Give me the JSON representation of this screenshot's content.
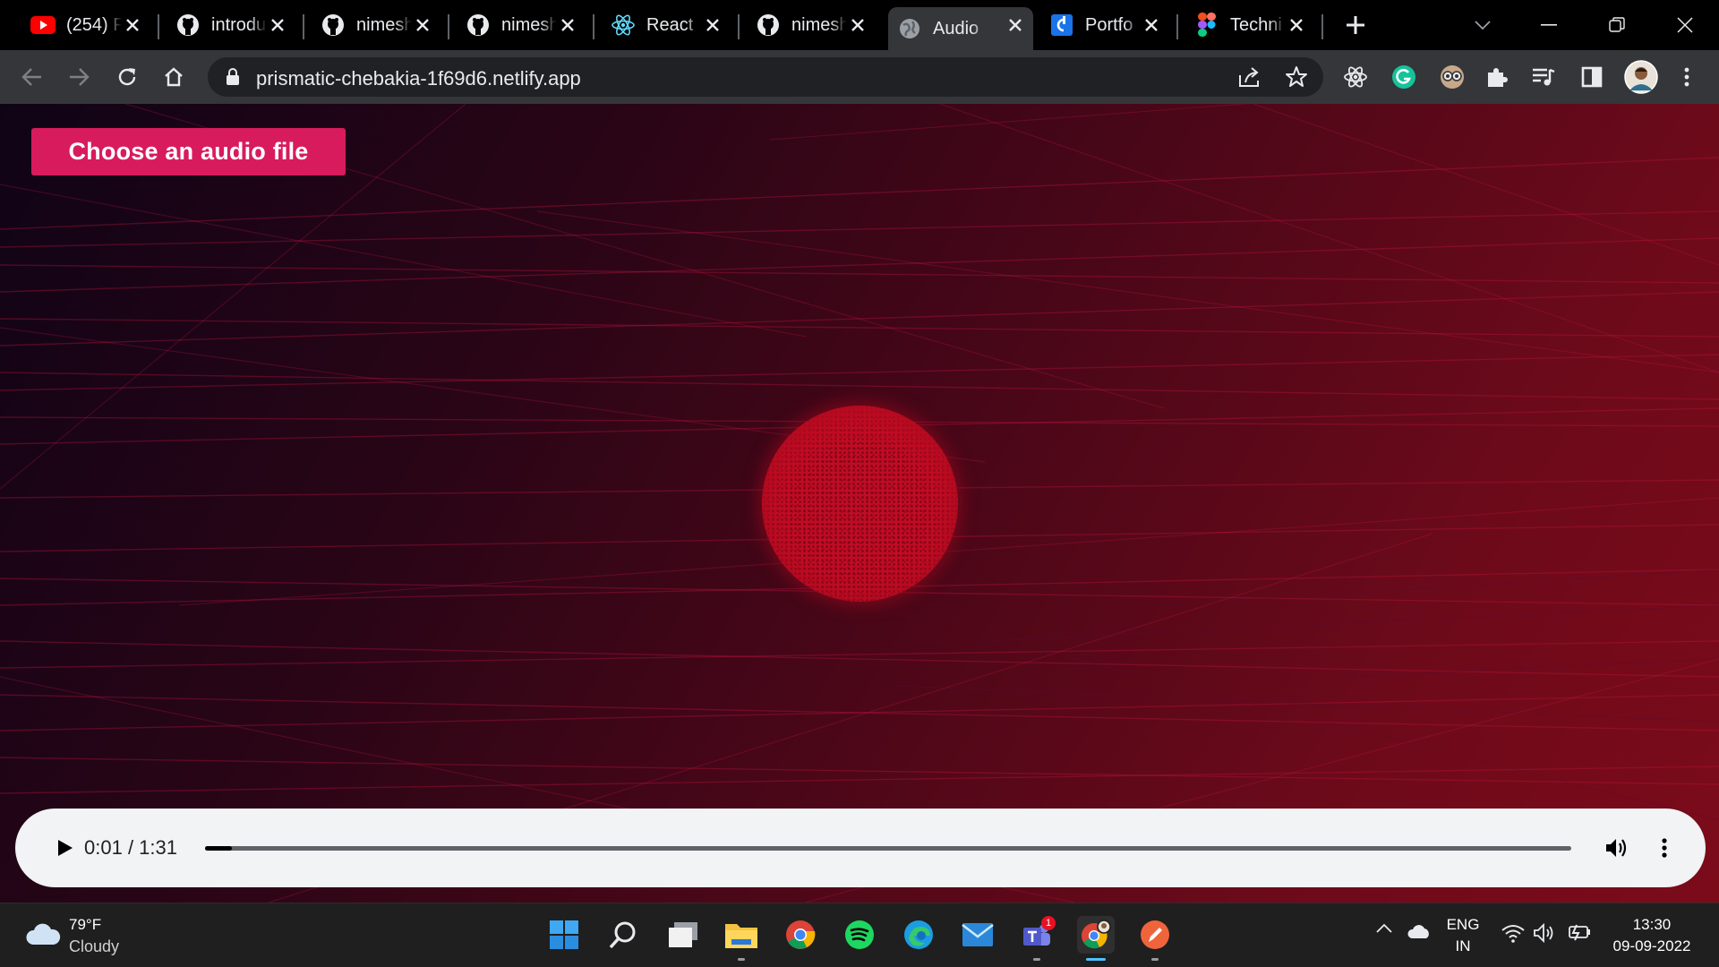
{
  "browser": {
    "tabs": [
      {
        "title": "(254) F",
        "icon": "youtube-icon",
        "active": false
      },
      {
        "title": "introdu",
        "icon": "github-icon",
        "active": false
      },
      {
        "title": "nimesh",
        "icon": "github-icon",
        "active": false
      },
      {
        "title": "nimesh",
        "icon": "github-icon",
        "active": false
      },
      {
        "title": "React",
        "icon": "react-icon",
        "active": false
      },
      {
        "title": "nimesh",
        "icon": "github-icon",
        "active": false
      },
      {
        "title": "Audio",
        "icon": "globe-icon",
        "active": true
      },
      {
        "title": "Portfo",
        "icon": "portfolio-icon",
        "active": false
      },
      {
        "title": "Techni",
        "icon": "figma-icon",
        "active": false
      }
    ],
    "url": "prismatic-chebakia-1f69d6.netlify.app",
    "colors": {
      "tabstrip": "#000000",
      "toolbar": "#35363a",
      "omnibox": "#202124"
    }
  },
  "page": {
    "choose_button_label": "Choose an audio file",
    "colors": {
      "button": "#d81b5c",
      "orb": "#c00d24",
      "background_dark": "#0f0416",
      "background_red": "#7c0b1a"
    }
  },
  "player": {
    "current_time": "0:01",
    "duration": "1:31",
    "time_display": "0:01 / 1:31",
    "progress_fraction": 0.011
  },
  "taskbar": {
    "weather": {
      "temp": "79°F",
      "condition": "Cloudy"
    },
    "apps": [
      "start-icon",
      "search-icon",
      "task-view-icon",
      "file-explorer-icon",
      "chrome-icon",
      "spotify-icon",
      "edge-icon",
      "mail-icon",
      "teams-icon",
      "chrome-profile-icon",
      "pen-app-icon"
    ],
    "teams_badge": "1",
    "language": "ENG",
    "region": "IN",
    "time": "13:30",
    "date": "09-09-2022"
  }
}
